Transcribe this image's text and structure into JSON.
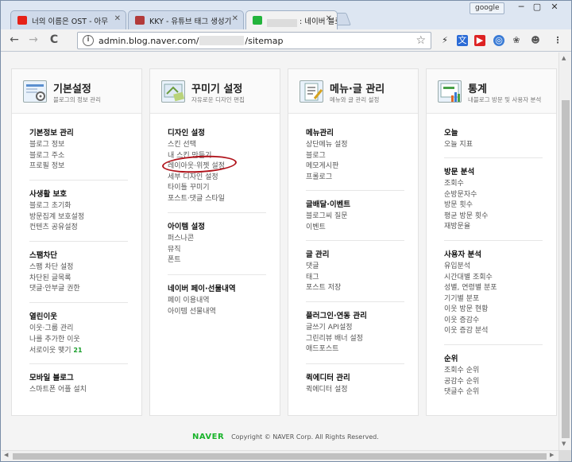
{
  "browser": {
    "tabs": [
      {
        "label": "너의 이름은 OST - 아무",
        "favicon_color": "#e62117"
      },
      {
        "label": "KKY - 유튜브 태그 생성기",
        "favicon_color": "#b23a3a"
      },
      {
        "label": ": 네이버 블로그",
        "favicon_color": "#23b43c"
      }
    ],
    "profile": "google",
    "window_buttons": [
      "─",
      "▢",
      "✕"
    ],
    "url_prefix": "admin.blog.naver.com/",
    "url_suffix": "/sitemap",
    "nav": {
      "back": "←",
      "forward": "→",
      "reload": "C"
    }
  },
  "cards": [
    {
      "title": "기본설정",
      "subtitle": "블로그의 정보 관리",
      "sections": [
        {
          "title": "기본정보 관리",
          "items": [
            "블로그 정보",
            "블로그 주소",
            "프로필 정보"
          ]
        },
        {
          "title": "사생활 보호",
          "items": [
            "블로그 초기화",
            "방문집계 보호설정",
            "컨텐츠 공유설정"
          ]
        },
        {
          "title": "스팸차단",
          "items": [
            "스팸 차단 설정",
            "차단된 글목록",
            "댓글·안부글 권한"
          ]
        },
        {
          "title": "열린이웃",
          "items": [
            "이웃·그룹 관리",
            "나를 추가한 이웃",
            "서로이웃 맺기"
          ],
          "badge": "21"
        },
        {
          "title": "모바일 블로그",
          "items": [
            "스마트폰 어플 설치"
          ]
        }
      ]
    },
    {
      "title": "꾸미기 설정",
      "subtitle": "자유로운 디자인 편집",
      "sections": [
        {
          "title": "디자인 설정",
          "items": [
            "스킨 선택",
            "내 스킨 만들기",
            "레이아웃·위젯 설정",
            "세부 디자인 설정",
            "타이틀 꾸미기",
            "포스트·댓글 스타일"
          ]
        },
        {
          "title": "아이템 설정",
          "items": [
            "퍼스나콘",
            "뮤직",
            "폰트"
          ]
        },
        {
          "title": "네이버 페이·선물내역",
          "items": [
            "페이 이용내역",
            "아이템 선물내역"
          ]
        }
      ]
    },
    {
      "title": "메뉴·글 관리",
      "subtitle": "메뉴와 글 관리 설정",
      "sections": [
        {
          "title": "메뉴관리",
          "items": [
            "상단메뉴 설정",
            "블로그",
            "메모게시판",
            "프롤로그"
          ]
        },
        {
          "title": "글배달·이벤트",
          "items": [
            "블로그씨 질문",
            "이벤트"
          ]
        },
        {
          "title": "글 관리",
          "items": [
            "댓글",
            "태그",
            "포스트 저장"
          ]
        },
        {
          "title": "플러그인·연동 관리",
          "items": [
            "글쓰기 API설정",
            "그린리뷰 배너 설정",
            "애드포스트"
          ]
        },
        {
          "title": "퀵에디터 관리",
          "items": [
            "퀵에디터 설정"
          ]
        }
      ]
    },
    {
      "title": "통계",
      "subtitle": "내블로그 방문 및 사용자 분석",
      "sections": [
        {
          "title": "오늘",
          "items": [
            "오늘 지표"
          ]
        },
        {
          "title": "방문 분석",
          "items": [
            "조회수",
            "순방문자수",
            "방문 횟수",
            "평균 방문 횟수",
            "재방문율"
          ]
        },
        {
          "title": "사용자 분석",
          "items": [
            "유입분석",
            "시간대별 조회수",
            "성별, 연령별 분포",
            "기기별 분포",
            "이웃 방문 현황",
            "이웃 증감수",
            "이웃 증감 분석"
          ]
        },
        {
          "title": "순위",
          "items": [
            "조회수 순위",
            "공감수 순위",
            "댓글수 순위"
          ]
        }
      ]
    }
  ],
  "footer": {
    "logo": "NAVER",
    "copyright": "Copyright © NAVER Corp. All Rights Reserved."
  },
  "colors": {
    "naver_green": "#19b42b",
    "highlight_red": "#b0131b",
    "badge_green": "#1a9f2c"
  }
}
